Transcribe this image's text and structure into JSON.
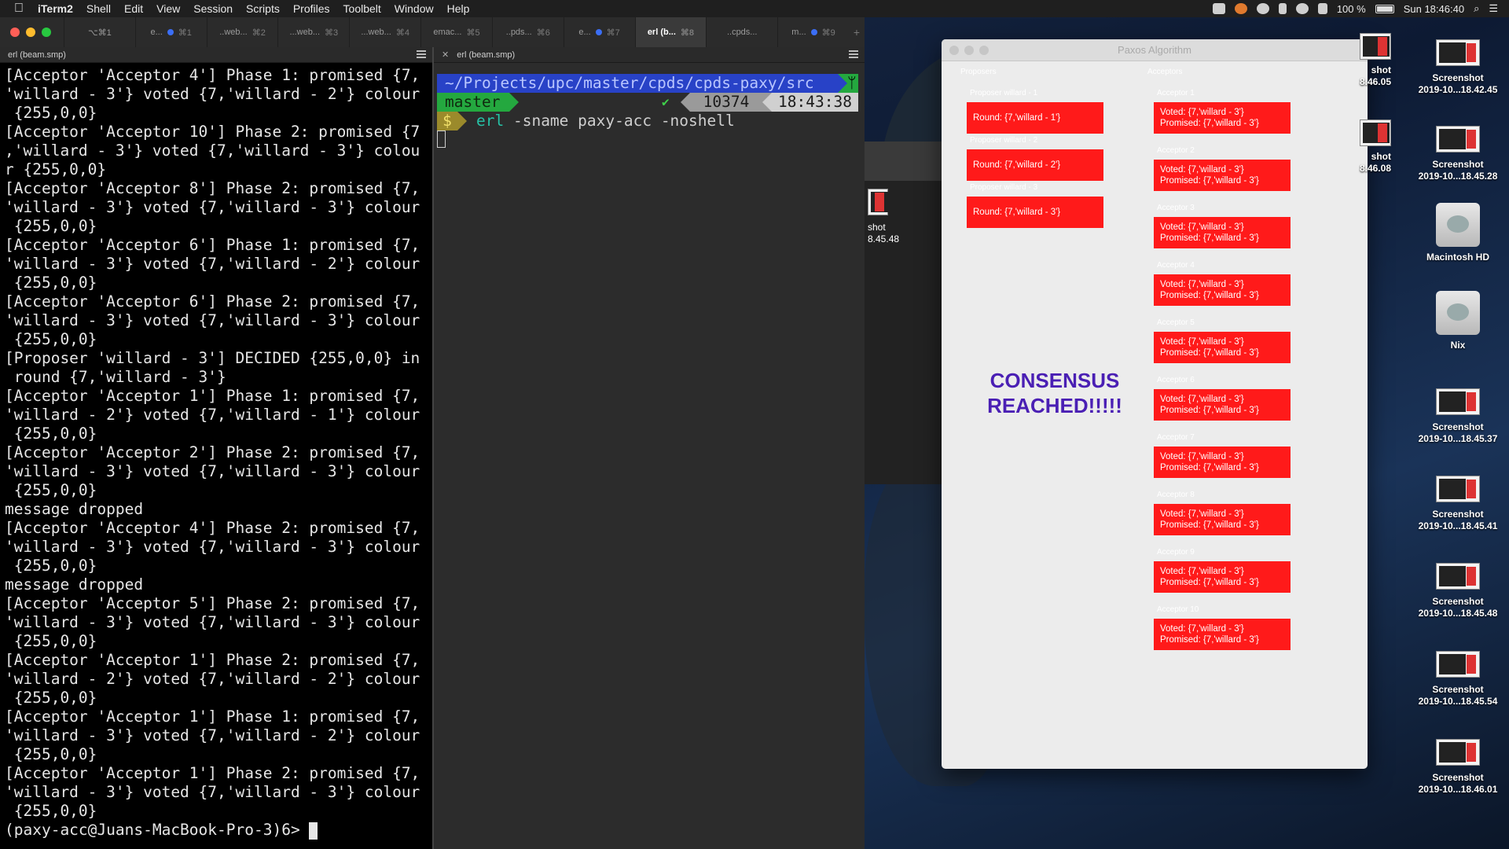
{
  "menubar": {
    "apple": "",
    "items": [
      "iTerm2",
      "Shell",
      "Edit",
      "View",
      "Session",
      "Scripts",
      "Profiles",
      "Toolbelt",
      "Window",
      "Help"
    ],
    "battery": "100 %",
    "clock": "Sun 18:46:40"
  },
  "iterm": {
    "tabs": [
      {
        "label": "⌥⌘1",
        "dot": false,
        "sc": ""
      },
      {
        "label": "e...",
        "dot": true,
        "sc": "⌘1"
      },
      {
        "label": "..web...",
        "dot": false,
        "sc": "⌘2"
      },
      {
        "label": "...web...",
        "dot": false,
        "sc": "⌘3"
      },
      {
        "label": "...web...",
        "dot": false,
        "sc": "⌘4"
      },
      {
        "label": "emac...",
        "dot": false,
        "sc": "⌘5"
      },
      {
        "label": "..pds...",
        "dot": false,
        "sc": "⌘6"
      },
      {
        "label": "e...",
        "dot": true,
        "sc": "⌘7"
      },
      {
        "label": "erl (b...",
        "dot": false,
        "sc": "⌘8"
      },
      {
        "label": "..cpds...",
        "dot": false,
        "sc": ""
      },
      {
        "label": "m...",
        "dot": true,
        "sc": "⌘9"
      }
    ],
    "left_pane": {
      "title": "erl (beam.smp)",
      "lines": [
        "[Acceptor 'Acceptor 4'] Phase 1: promised {7,",
        "'willard - 3'} voted {7,'willard - 2'} colour",
        " {255,0,0}",
        "[Acceptor 'Acceptor 10'] Phase 2: promised {7",
        ",'willard - 3'} voted {7,'willard - 3'} colou",
        "r {255,0,0}",
        "[Acceptor 'Acceptor 8'] Phase 2: promised {7,",
        "'willard - 3'} voted {7,'willard - 3'} colour",
        " {255,0,0}",
        "[Acceptor 'Acceptor 6'] Phase 1: promised {7,",
        "'willard - 3'} voted {7,'willard - 2'} colour",
        " {255,0,0}",
        "[Acceptor 'Acceptor 6'] Phase 2: promised {7,",
        "'willard - 3'} voted {7,'willard - 3'} colour",
        " {255,0,0}",
        "[Proposer 'willard - 3'] DECIDED {255,0,0} in",
        " round {7,'willard - 3'}",
        "[Acceptor 'Acceptor 1'] Phase 1: promised {7,",
        "'willard - 2'} voted {7,'willard - 1'} colour",
        " {255,0,0}",
        "[Acceptor 'Acceptor 2'] Phase 2: promised {7,",
        "'willard - 3'} voted {7,'willard - 3'} colour",
        " {255,0,0}",
        "message dropped",
        "[Acceptor 'Acceptor 4'] Phase 2: promised {7,",
        "'willard - 3'} voted {7,'willard - 3'} colour",
        " {255,0,0}",
        "message dropped",
        "[Acceptor 'Acceptor 5'] Phase 2: promised {7,",
        "'willard - 3'} voted {7,'willard - 3'} colour",
        " {255,0,0}",
        "[Acceptor 'Acceptor 1'] Phase 2: promised {7,",
        "'willard - 2'} voted {7,'willard - 2'} colour",
        " {255,0,0}",
        "[Acceptor 'Acceptor 1'] Phase 1: promised {7,",
        "'willard - 3'} voted {7,'willard - 2'} colour",
        " {255,0,0}",
        "[Acceptor 'Acceptor 1'] Phase 2: promised {7,",
        "'willard - 3'} voted {7,'willard - 3'} colour",
        " {255,0,0}"
      ],
      "prompt": "(paxy-acc@Juans-MacBook-Pro-3)6> "
    },
    "right_pane": {
      "title": "erl (beam.smp)",
      "path": "~/Projects/upc/master/cpds/cpds-paxy/src",
      "git_icon": "ᛘ",
      "branch": "master",
      "check": "✔",
      "pid": "10374",
      "time": "18:43:38",
      "dollar": "$",
      "cmd": "erl",
      "cmd_args": " -sname paxy-acc -noshell"
    }
  },
  "paxos": {
    "title": "Paxos Algorithm",
    "proposers_header": "Proposers",
    "acceptors_header": "Acceptors",
    "proposers": [
      {
        "label": "Proposer willard - 1",
        "round": "Round: {7,'willard - 1'}"
      },
      {
        "label": "Proposer willard - 2",
        "round": "Round: {7,'willard - 2'}"
      },
      {
        "label": "Proposer willard - 3",
        "round": "Round: {7,'willard - 3'}"
      }
    ],
    "acceptors": [
      {
        "label": "Acceptor 1",
        "voted": "Voted: {7,'willard - 3'}",
        "promised": "Promised: {7,'willard - 3'}"
      },
      {
        "label": "Acceptor 2",
        "voted": "Voted: {7,'willard - 3'}",
        "promised": "Promised: {7,'willard - 3'}"
      },
      {
        "label": "Acceptor 3",
        "voted": "Voted: {7,'willard - 3'}",
        "promised": "Promised: {7,'willard - 3'}"
      },
      {
        "label": "Acceptor 4",
        "voted": "Voted: {7,'willard - 3'}",
        "promised": "Promised: {7,'willard - 3'}"
      },
      {
        "label": "Acceptor 5",
        "voted": "Voted: {7,'willard - 3'}",
        "promised": "Promised: {7,'willard - 3'}"
      },
      {
        "label": "Acceptor 6",
        "voted": "Voted: {7,'willard - 3'}",
        "promised": "Promised: {7,'willard - 3'}"
      },
      {
        "label": "Acceptor 7",
        "voted": "Voted: {7,'willard - 3'}",
        "promised": "Promised: {7,'willard - 3'}"
      },
      {
        "label": "Acceptor 8",
        "voted": "Voted: {7,'willard - 3'}",
        "promised": "Promised: {7,'willard - 3'}"
      },
      {
        "label": "Acceptor 9",
        "voted": "Voted: {7,'willard - 3'}",
        "promised": "Promised: {7,'willard - 3'}"
      },
      {
        "label": "Acceptor 10",
        "voted": "Voted: {7,'willard - 3'}",
        "promised": "Promised: {7,'willard - 3'}"
      }
    ],
    "consensus_line1": "CONSENSUS",
    "consensus_line2": "REACHED!!!!!",
    "box_color": "#ff1a1a",
    "consensus_color": "#4a1fb4"
  },
  "background_window": {
    "label_line1": "shot",
    "label_line2": "8.45.48"
  },
  "desktop": {
    "partial_icons": [
      {
        "line1": "shot",
        "line2": "8.46.05"
      },
      {
        "line1": "shot",
        "line2": "8.46.08"
      }
    ],
    "icons": [
      {
        "kind": "screenshot",
        "line1": "Screenshot",
        "line2": "2019-10...18.42.45"
      },
      {
        "kind": "screenshot",
        "line1": "Screenshot",
        "line2": "2019-10...18.45.28"
      },
      {
        "kind": "disk",
        "line1": "Macintosh HD",
        "line2": ""
      },
      {
        "kind": "disk",
        "line1": "Nix",
        "line2": ""
      },
      {
        "kind": "screenshot",
        "line1": "Screenshot",
        "line2": "2019-10...18.45.37"
      },
      {
        "kind": "screenshot",
        "line1": "Screenshot",
        "line2": "2019-10...18.45.41"
      },
      {
        "kind": "screenshot",
        "line1": "Screenshot",
        "line2": "2019-10...18.45.48"
      },
      {
        "kind": "screenshot",
        "line1": "Screenshot",
        "line2": "2019-10...18.45.54"
      },
      {
        "kind": "screenshot",
        "line1": "Screenshot",
        "line2": "2019-10...18.46.01"
      }
    ]
  }
}
